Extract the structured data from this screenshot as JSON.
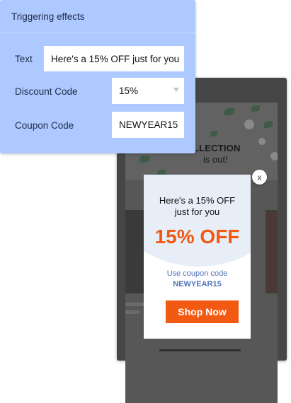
{
  "panel": {
    "title": "Triggering effects",
    "fields": {
      "text": {
        "label": "Text",
        "value": "Here's a 15% OFF just for you"
      },
      "discount": {
        "label": "Discount Code",
        "value": "15%"
      },
      "coupon": {
        "label": "Coupon Code",
        "value": "NEWYEAR15"
      }
    }
  },
  "phone": {
    "hero_title": "LLECTION",
    "hero_sub": "is out!"
  },
  "popup": {
    "headline_line1": "Here's a 15% OFF",
    "headline_line2": "just for you",
    "discount": "15% OFF",
    "coupon_label": "Use coupon code",
    "coupon_code": "NEWYEAR15",
    "button_label": "Shop Now",
    "close_label": "x"
  },
  "colors": {
    "panel_bg": "#aec9ff",
    "accent_orange": "#f25a14",
    "coupon_blue": "#4f73b8",
    "phone_dark": "#464646"
  },
  "icons": [
    "close-icon",
    "chevron-down-icon"
  ]
}
